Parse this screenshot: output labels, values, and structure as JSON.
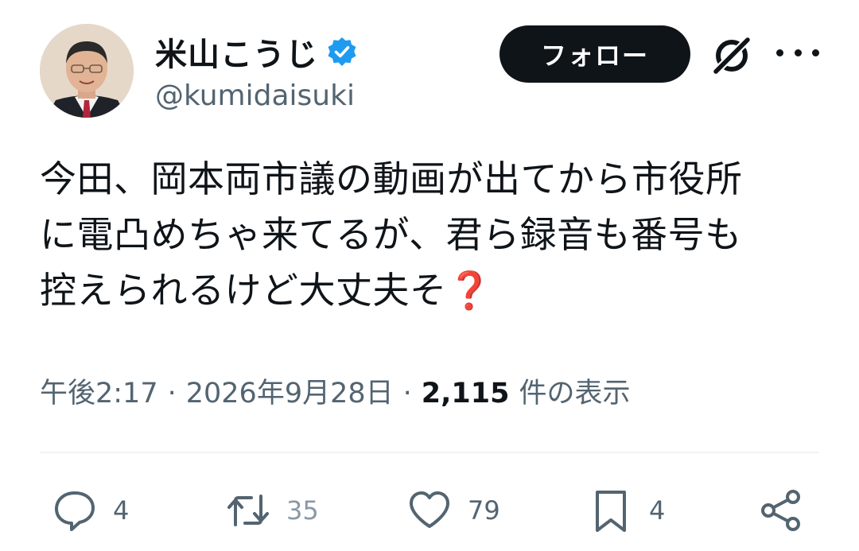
{
  "author": {
    "display_name": "米山こうじ",
    "handle": "@kumidaisuki",
    "verified": true,
    "verified_color": "#1d9bf0"
  },
  "header_actions": {
    "follow_label": "フォロー",
    "icons": [
      "grok-icon",
      "more-icon"
    ]
  },
  "tweet": {
    "text": "今田、岡本両市議の動画が出てから市役所\nに電凸めちゃ来てるが、君ら録音も番号も\n控えられるけど大丈夫そ❓"
  },
  "meta": {
    "time": "午後2:17",
    "separator": "·",
    "date": "2026年9月28日",
    "views_count": "2,115",
    "views_label": "件の表示"
  },
  "actions": {
    "reply_count": "4",
    "retweet_count": "35",
    "like_count": "79",
    "bookmark_count": "4"
  },
  "colors": {
    "text": "#0f1419",
    "muted": "#536471",
    "follow_bg": "#0f1419",
    "divider": "#eff3f4"
  }
}
